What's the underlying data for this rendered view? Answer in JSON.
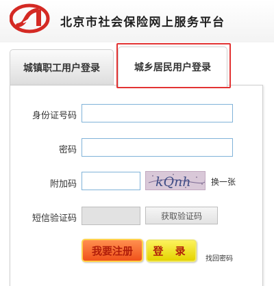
{
  "header": {
    "title": "北京市社会保险网上服务平台",
    "logo_icon": "si-logo-icon",
    "brand_color": "#d42a24"
  },
  "tabs": [
    {
      "label": "城镇职工用户登录",
      "active": false
    },
    {
      "label": "城乡居民用户登录",
      "active": true
    }
  ],
  "form": {
    "id_label": "身份证号码",
    "id_value": "",
    "password_label": "密码",
    "password_value": "",
    "captcha_label": "附加码",
    "captcha_value": "",
    "captcha_text": "kQnh",
    "refresh_label": "换一张",
    "sms_label": "短信验证码",
    "sms_value": "",
    "sms_button": "获取验证码"
  },
  "actions": {
    "register": "我要注册",
    "login": "登 录",
    "forgot": "找回密码"
  },
  "colors": {
    "highlight": "#e23232",
    "input_border": "#7fb2d8",
    "register_bg": "#f0521b",
    "login_bg": "#e4d300"
  }
}
